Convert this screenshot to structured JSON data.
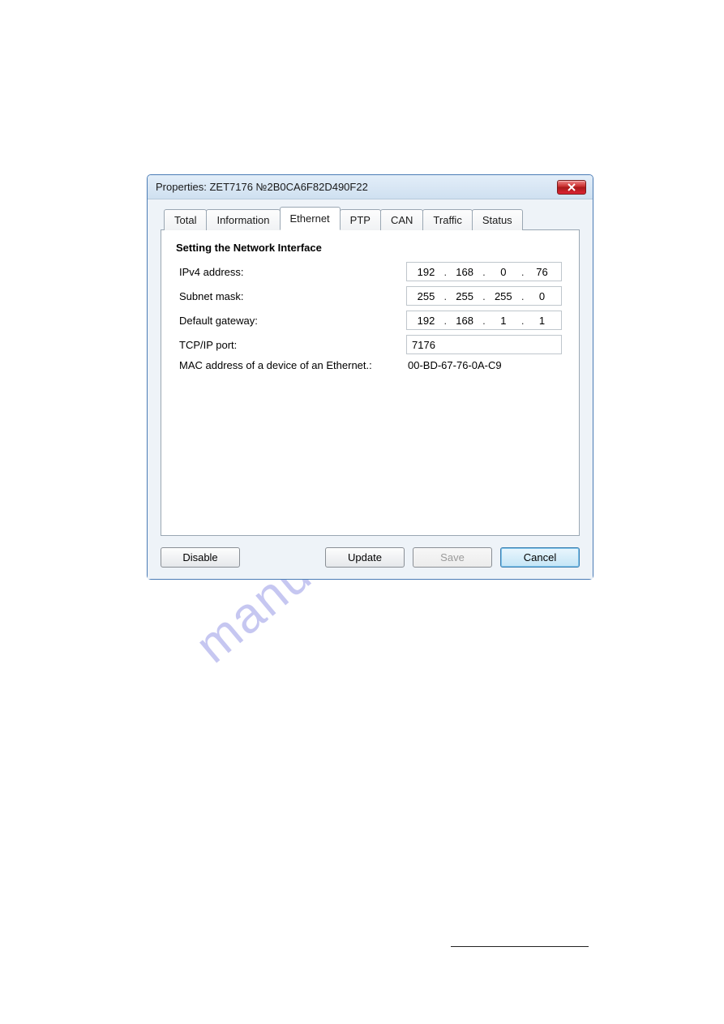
{
  "window": {
    "title": "Properties: ZET7176 №2B0CA6F82D490F22"
  },
  "tabs": [
    "Total",
    "Information",
    "Ethernet",
    "PTP",
    "CAN",
    "Traffic",
    "Status"
  ],
  "active_tab": "Ethernet",
  "panel": {
    "heading": "Setting the Network Interface",
    "rows": {
      "ipv4_label": "IPv4 address:",
      "ipv4": [
        "192",
        "168",
        "0",
        "76"
      ],
      "subnet_label": "Subnet mask:",
      "subnet": [
        "255",
        "255",
        "255",
        "0"
      ],
      "gateway_label": "Default gateway:",
      "gateway": [
        "192",
        "168",
        "1",
        "1"
      ],
      "port_label": "TCP/IP port:",
      "port": "7176",
      "mac_label": "MAC address of a device of an Ethernet.:",
      "mac": "00-BD-67-76-0A-C9"
    }
  },
  "buttons": {
    "disable": "Disable",
    "update": "Update",
    "save": "Save",
    "cancel": "Cancel"
  },
  "watermark": "manualshive.com"
}
